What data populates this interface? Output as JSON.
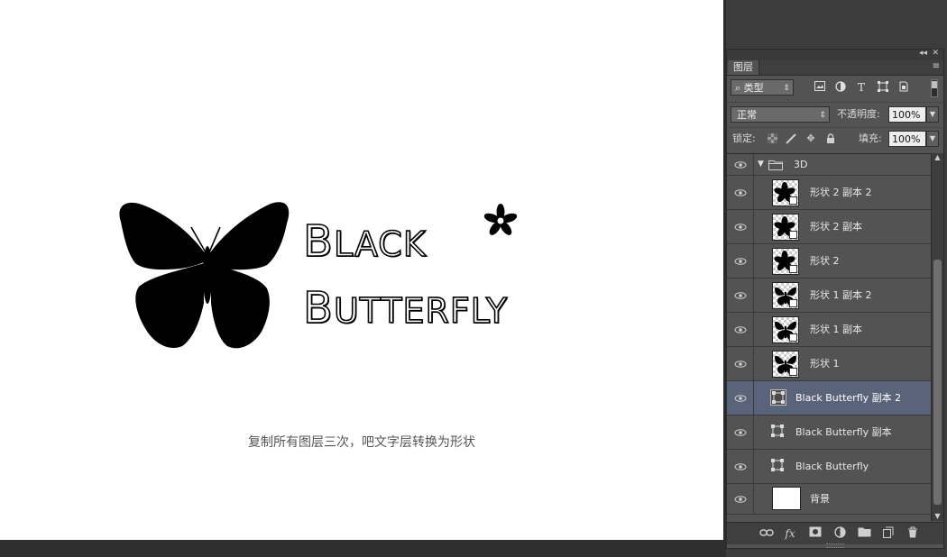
{
  "canvas": {
    "wordmark_line1": {
      "first": "B",
      "rest": "LACK"
    },
    "wordmark_line2": {
      "first": "B",
      "rest": "UTTERFLY"
    },
    "caption": "复制所有图层三次，吧文字层转换为形状"
  },
  "panel": {
    "tab_label": "图层",
    "menu_icon": "≡",
    "collapse_icon": "◂◂",
    "close_icon": "✕",
    "filter": {
      "search_icon": "⌕",
      "kind_label": "类型",
      "icons": [
        "image-filter-icon",
        "adjustment-filter-icon",
        "type-filter-icon",
        "shape-filter-icon",
        "smart-object-filter-icon"
      ]
    },
    "blend_mode": "正常",
    "opacity_label": "不透明度:",
    "opacity_value": "100%",
    "lock_label": "锁定:",
    "fill_label": "填充:",
    "fill_value": "100%",
    "layers": [
      {
        "name": "3D",
        "type": "group",
        "selected": false
      },
      {
        "name": "形状 2 副本 2",
        "type": "shape-flower",
        "selected": false
      },
      {
        "name": "形状 2 副本",
        "type": "shape-flower",
        "selected": false
      },
      {
        "name": "形状 2",
        "type": "shape-flower",
        "selected": false
      },
      {
        "name": "形状 1 副本 2",
        "type": "shape-butterfly",
        "selected": false
      },
      {
        "name": "形状 1 副本",
        "type": "shape-butterfly",
        "selected": false
      },
      {
        "name": "形状 1",
        "type": "shape-butterfly",
        "selected": false
      },
      {
        "name": "Black Butterfly 副本 2",
        "type": "text-shape",
        "selected": true
      },
      {
        "name": "Black Butterfly 副本",
        "type": "text-shape",
        "selected": false
      },
      {
        "name": "Black Butterfly",
        "type": "text-shape",
        "selected": false
      },
      {
        "name": "背景",
        "type": "background",
        "selected": false
      }
    ],
    "bottom_icons": [
      "link-layers-icon",
      "fx-icon",
      "add-mask-icon",
      "adjustment-layer-icon",
      "new-group-icon",
      "new-layer-icon",
      "delete-layer-icon"
    ],
    "fx_label": "fx"
  },
  "colors": {
    "selected_row": "#59637a",
    "panel_bg": "#535353",
    "app_bg": "#3c3c3c"
  }
}
